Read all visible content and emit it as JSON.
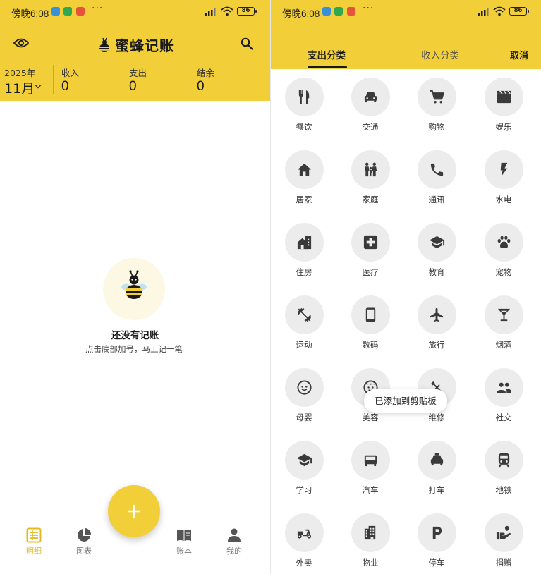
{
  "colors": {
    "accent": "#f2cf39",
    "icon_bg": "#ececec",
    "text": "#1a1a1a",
    "nav_active": "#e2bc1e",
    "nav_inactive": "#777777"
  },
  "status_bar": {
    "time": "傍晚6:08",
    "more": "···",
    "battery": "86"
  },
  "left": {
    "app_title": "蜜蜂记账",
    "year": "2025年",
    "month": "11月",
    "summary": [
      {
        "label": "收入",
        "value": "0"
      },
      {
        "label": "支出",
        "value": "0"
      },
      {
        "label": "结余",
        "value": "0"
      }
    ],
    "empty": {
      "title": "还没有记账",
      "subtitle": "点击底部加号，马上记一笔"
    },
    "nav": [
      {
        "label": "明细",
        "icon": "list-icon",
        "active": true
      },
      {
        "label": "图表",
        "icon": "pie-chart-icon",
        "active": false
      },
      {
        "label": "账本",
        "icon": "book-icon",
        "active": false
      },
      {
        "label": "我的",
        "icon": "person-icon",
        "active": false
      }
    ]
  },
  "right": {
    "tabs": [
      {
        "label": "支出分类",
        "active": true
      },
      {
        "label": "收入分类",
        "active": false
      }
    ],
    "cancel": "取消",
    "categories": [
      {
        "label": "餐饮",
        "icon": "utensils-icon"
      },
      {
        "label": "交通",
        "icon": "car-icon"
      },
      {
        "label": "购物",
        "icon": "cart-icon"
      },
      {
        "label": "娱乐",
        "icon": "clapperboard-icon"
      },
      {
        "label": "居家",
        "icon": "home-icon"
      },
      {
        "label": "家庭",
        "icon": "family-icon"
      },
      {
        "label": "通讯",
        "icon": "phone-icon"
      },
      {
        "label": "水电",
        "icon": "bolt-icon"
      },
      {
        "label": "住房",
        "icon": "building-house-icon"
      },
      {
        "label": "医疗",
        "icon": "medical-cross-icon"
      },
      {
        "label": "教育",
        "icon": "graduation-cap-icon"
      },
      {
        "label": "宠物",
        "icon": "paw-icon"
      },
      {
        "label": "运动",
        "icon": "dumbbell-icon"
      },
      {
        "label": "数码",
        "icon": "smartphone-icon"
      },
      {
        "label": "旅行",
        "icon": "airplane-icon"
      },
      {
        "label": "烟酒",
        "icon": "cocktail-icon"
      },
      {
        "label": "母婴",
        "icon": "baby-face-icon"
      },
      {
        "label": "美容",
        "icon": "face-icon"
      },
      {
        "label": "维修",
        "icon": "tools-icon"
      },
      {
        "label": "社交",
        "icon": "people-icon"
      },
      {
        "label": "学习",
        "icon": "school-icon"
      },
      {
        "label": "汽车",
        "icon": "car-front-icon"
      },
      {
        "label": "打车",
        "icon": "taxi-icon"
      },
      {
        "label": "地铁",
        "icon": "subway-icon"
      },
      {
        "label": "外卖",
        "icon": "delivery-scooter-icon"
      },
      {
        "label": "物业",
        "icon": "apartment-icon"
      },
      {
        "label": "停车",
        "icon": "parking-icon"
      },
      {
        "label": "捐赠",
        "icon": "donation-icon"
      }
    ],
    "toast": "已添加到剪贴板"
  }
}
